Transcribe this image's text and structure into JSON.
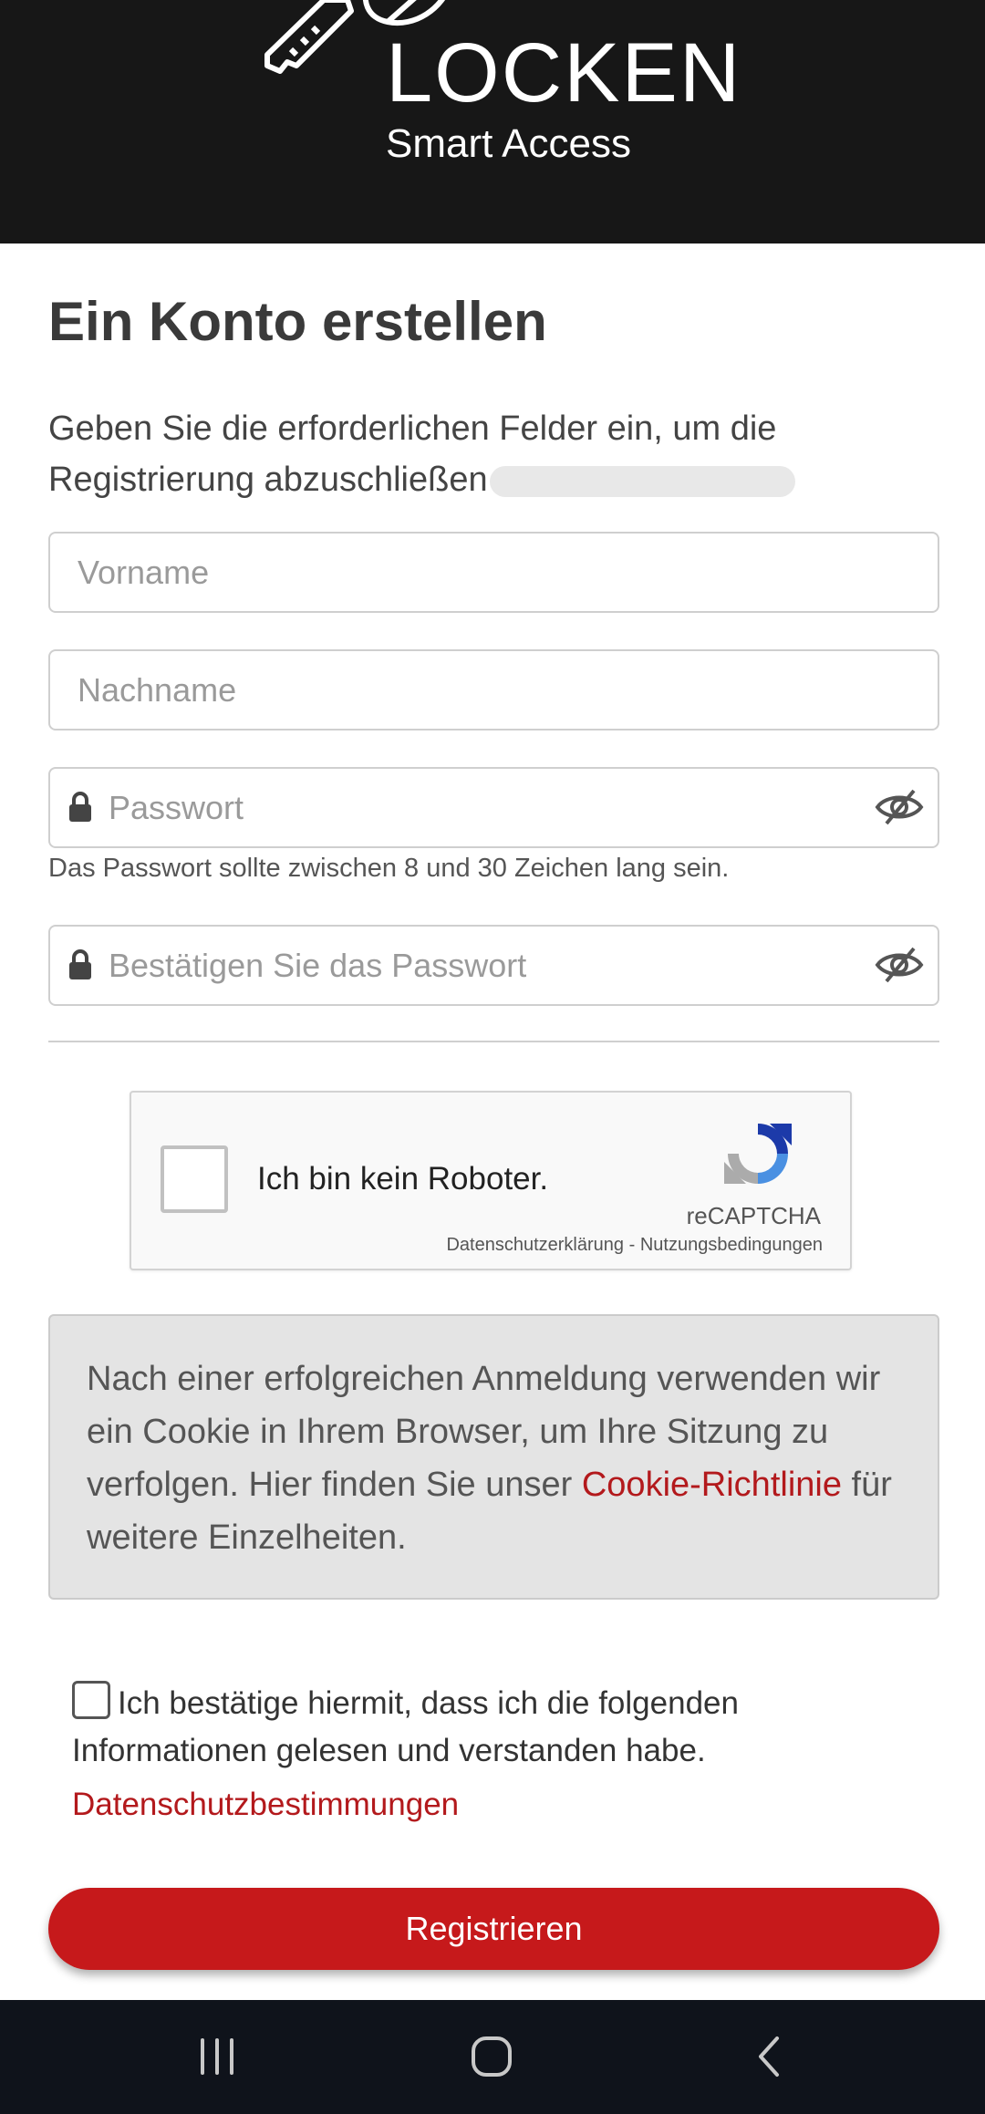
{
  "header": {
    "brand": "LOCKEN",
    "subtitle": "Smart Access",
    "logo_icon": "key-icon"
  },
  "page": {
    "title": "Ein Konto erstellen",
    "intro": "Geben Sie die erforderlichen Felder ein, um die Registrierung abzuschließen"
  },
  "form": {
    "first_name_placeholder": "Vorname",
    "last_name_placeholder": "Nachname",
    "password_placeholder": "Passwort",
    "password_hint": "Das Passwort sollte zwischen 8 und 30 Zeichen lang sein.",
    "confirm_password_placeholder": "Bestätigen Sie das Passwort"
  },
  "captcha": {
    "label": "Ich bin kein Roboter.",
    "brand": "reCAPTCHA",
    "privacy": "Datenschutzerklärung",
    "separator": "-",
    "terms": "Nutzungsbedingungen"
  },
  "cookie_notice": {
    "text_before": "Nach einer erfolgreichen Anmeldung verwenden wir ein Cookie in Ihrem Browser, um Ihre Sitzung zu verfolgen. Hier finden Sie unser ",
    "link": "Cookie-Richtlinie",
    "text_after": " für weitere Einzelheiten."
  },
  "consent": {
    "text": "Ich bestätige hiermit, dass ich die folgenden Informationen gelesen und verstanden habe.",
    "link": "Datenschutzbestimmungen"
  },
  "actions": {
    "register_label": "Registrieren"
  },
  "colors": {
    "accent": "#c6191b",
    "header_bg": "#171717",
    "navbar_bg": "#0f131b"
  },
  "navbar": {
    "icons": [
      "recent-apps-icon",
      "home-icon",
      "back-icon"
    ]
  }
}
